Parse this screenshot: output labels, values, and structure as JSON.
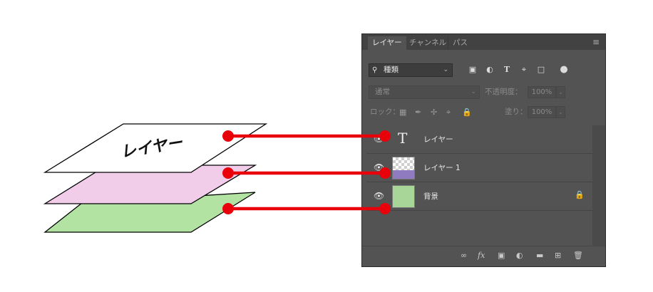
{
  "colors": {
    "connector": "#e8000b",
    "sheet_top": "#ffffff",
    "sheet_middle": "#f2cdea",
    "sheet_bottom": "#b3e3a3",
    "panel_bg": "#535353"
  },
  "illustration": {
    "top_sheet_label": "レイヤー"
  },
  "panel": {
    "tabs": [
      "レイヤー",
      "チャンネル",
      "パス"
    ],
    "menu_icon": "hamburger-icon",
    "filter": {
      "kind_label": "種類",
      "icons": [
        "image-filter-icon",
        "adjustment-filter-icon",
        "type-filter-icon",
        "shape-filter-icon",
        "smart-object-filter-icon",
        "filter-toggle-icon"
      ]
    },
    "blend_mode": "通常",
    "opacity_label": "不透明度：",
    "opacity_value": "100%",
    "lock_label": "ロック：",
    "fill_label": "塗り：",
    "fill_value": "100%",
    "layers": [
      {
        "name": "レイヤー",
        "thumb": "type-icon",
        "thumb_text": "T",
        "locked": false
      },
      {
        "name": "レイヤー 1",
        "thumb": "transparent-purple",
        "locked": false
      },
      {
        "name": "背景",
        "thumb": "green-fill",
        "locked": true
      }
    ],
    "bottom_icons": [
      "link-icon",
      "fx-icon",
      "mask-icon",
      "adjustment-layer-icon",
      "folder-icon",
      "new-layer-icon",
      "trash-icon"
    ]
  }
}
